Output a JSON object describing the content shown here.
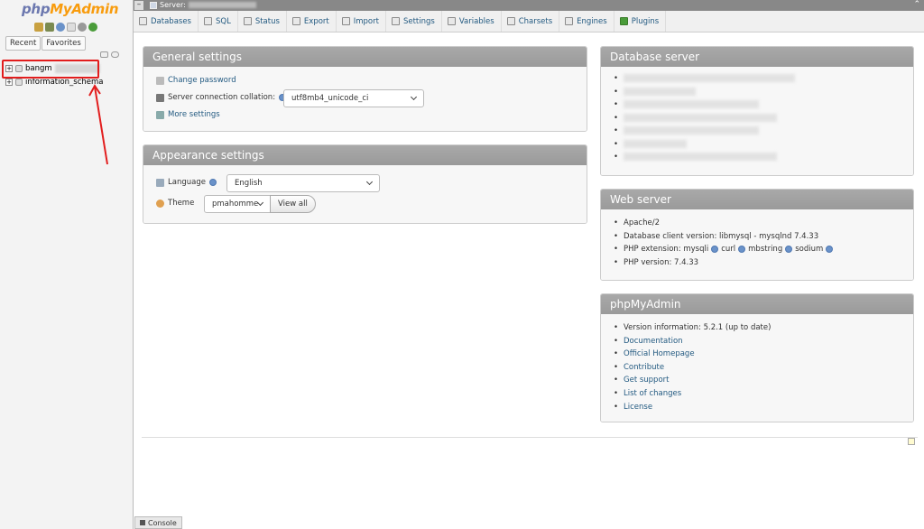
{
  "logo": {
    "php": "php",
    "my": "My",
    "admin": "Admin"
  },
  "sidebar": {
    "tabs": [
      "Recent",
      "Favorites"
    ],
    "databases": [
      {
        "name": "bangm"
      },
      {
        "name": "information_schema"
      }
    ]
  },
  "topbar": {
    "label": "Server:"
  },
  "nav": {
    "tabs": [
      "Databases",
      "SQL",
      "Status",
      "Export",
      "Import",
      "Settings",
      "Variables",
      "Charsets",
      "Engines",
      "Plugins"
    ]
  },
  "general": {
    "title": "General settings",
    "change_password": "Change password",
    "collation_label": "Server connection collation:",
    "collation_value": "utf8mb4_unicode_ci",
    "more_settings": "More settings"
  },
  "appearance": {
    "title": "Appearance settings",
    "language_label": "Language",
    "language_value": "English",
    "theme_label": "Theme",
    "theme_value": "pmahomme",
    "view_all": "View all"
  },
  "db_server": {
    "title": "Database server"
  },
  "web_server": {
    "title": "Web server",
    "items": {
      "server": "Apache/2",
      "client": "Database client version: libmysql - mysqlnd 7.4.33",
      "ext_label": "PHP extension: mysqli",
      "ext_curl": "curl",
      "ext_mbstring": "mbstring",
      "ext_sodium": "sodium",
      "php_version": "PHP version: 7.4.33"
    }
  },
  "pma": {
    "title": "phpMyAdmin",
    "version": "Version information: 5.2.1 (up to date)",
    "links": [
      "Documentation",
      "Official Homepage",
      "Contribute",
      "Get support",
      "List of changes",
      "License"
    ]
  },
  "console": {
    "label": "Console"
  },
  "colors": {
    "accent_link": "#235a81",
    "panel_header": "#a0a0a0",
    "highlight": "#e21d1d"
  }
}
